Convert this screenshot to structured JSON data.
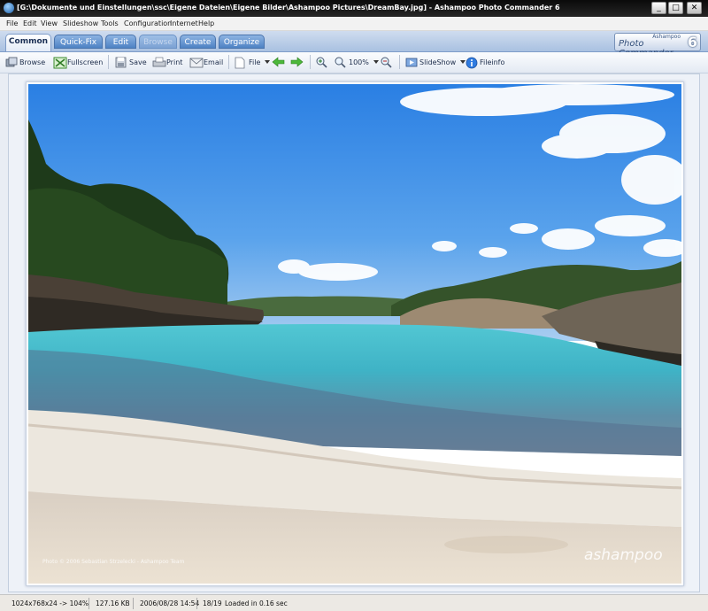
{
  "window": {
    "title": "[G:\\Dokumente und Einstellungen\\ssc\\Eigene Dateien\\Eigene Bilder\\Ashampoo Pictures\\DreamBay.jpg] - Ashampoo Photo Commander 6",
    "minimize_glyph": "_",
    "maximize_glyph": "□",
    "close_glyph": "✕"
  },
  "menu": [
    "File",
    "Edit",
    "View",
    "Slideshow",
    "Tools",
    "Configuration",
    "Internet",
    "Help"
  ],
  "tabs": [
    {
      "label": "Common",
      "state": "active"
    },
    {
      "label": "Quick-Fix",
      "state": "normal"
    },
    {
      "label": "Edit",
      "state": "normal"
    },
    {
      "label": "Browse",
      "state": "disabled"
    },
    {
      "label": "Create",
      "state": "normal"
    },
    {
      "label": "Organize",
      "state": "normal"
    }
  ],
  "logo": {
    "small": "Ashampoo",
    "big": "Photo Commander",
    "number": "6"
  },
  "toolbar": {
    "browse": "Browse",
    "fullscreen": "Fullscreen",
    "save": "Save",
    "print": "Print",
    "email": "Email",
    "file": "File",
    "zoom": "100%",
    "slideshow": "SlideShow",
    "fileinfo": "Fileinfo"
  },
  "photo": {
    "copyright": "Photo © 2006 Sebastian Strzelecki - Ashampoo Team",
    "watermark": "ashampoo"
  },
  "status": {
    "dimensions": "1024x768x24 -> 104%",
    "size": "127.16 KB",
    "date": "2006/08/28 14:54",
    "position": "18/19",
    "loaded": "Loaded in 0.16 sec"
  },
  "colors": {
    "titlebar": "#111111",
    "tab_active_text": "#1a2f55",
    "sky": "#3f8de3",
    "water": "#36b8c9",
    "sand": "#e6dac8"
  }
}
